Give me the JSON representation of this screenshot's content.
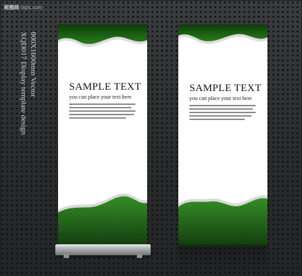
{
  "watermark": {
    "brand": "昵图网",
    "url": "nipic.com"
  },
  "caption": {
    "line1": "XQD017 Display template design",
    "line2": "800X1600mm Vector"
  },
  "banners": [
    {
      "title": "SAMPLE TEXT",
      "subtitle": "you can place your text here",
      "accent_color": "#1e6b12",
      "dark_color": "#0b3508",
      "has_stand": true
    },
    {
      "title": "SAMPLE TEXT",
      "subtitle": "you can place your text here",
      "accent_color": "#1e6b12",
      "dark_color": "#0b3508",
      "has_stand": false
    }
  ],
  "colors": {
    "background": "#2f3132",
    "banner": "#ffffff",
    "green": "#1e6b12"
  },
  "icons": {
    "stand": "rollup-stand-icon"
  }
}
